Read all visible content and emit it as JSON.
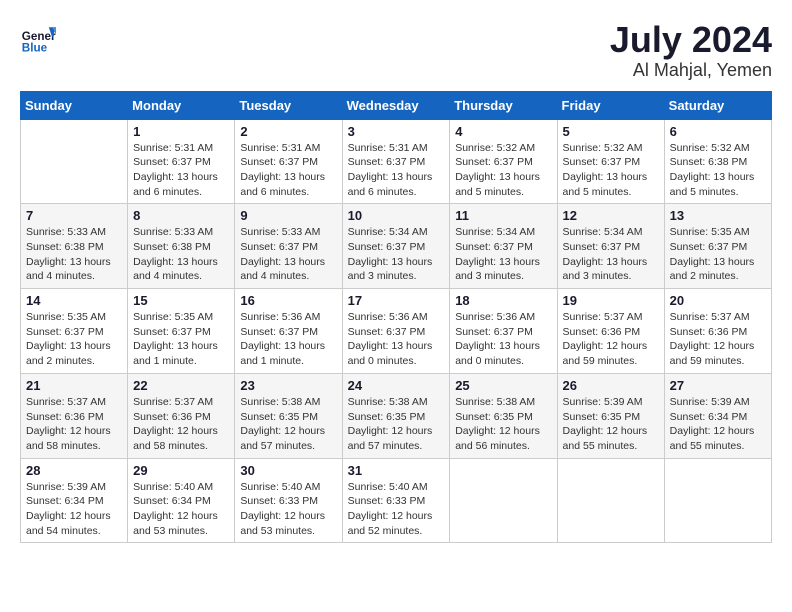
{
  "header": {
    "logo_line1": "General",
    "logo_line2": "Blue",
    "month": "July 2024",
    "location": "Al Mahjal, Yemen"
  },
  "weekdays": [
    "Sunday",
    "Monday",
    "Tuesday",
    "Wednesday",
    "Thursday",
    "Friday",
    "Saturday"
  ],
  "weeks": [
    [
      {
        "day": "",
        "info": ""
      },
      {
        "day": "1",
        "info": "Sunrise: 5:31 AM\nSunset: 6:37 PM\nDaylight: 13 hours\nand 6 minutes."
      },
      {
        "day": "2",
        "info": "Sunrise: 5:31 AM\nSunset: 6:37 PM\nDaylight: 13 hours\nand 6 minutes."
      },
      {
        "day": "3",
        "info": "Sunrise: 5:31 AM\nSunset: 6:37 PM\nDaylight: 13 hours\nand 6 minutes."
      },
      {
        "day": "4",
        "info": "Sunrise: 5:32 AM\nSunset: 6:37 PM\nDaylight: 13 hours\nand 5 minutes."
      },
      {
        "day": "5",
        "info": "Sunrise: 5:32 AM\nSunset: 6:37 PM\nDaylight: 13 hours\nand 5 minutes."
      },
      {
        "day": "6",
        "info": "Sunrise: 5:32 AM\nSunset: 6:38 PM\nDaylight: 13 hours\nand 5 minutes."
      }
    ],
    [
      {
        "day": "7",
        "info": "Sunrise: 5:33 AM\nSunset: 6:38 PM\nDaylight: 13 hours\nand 4 minutes."
      },
      {
        "day": "8",
        "info": "Sunrise: 5:33 AM\nSunset: 6:38 PM\nDaylight: 13 hours\nand 4 minutes."
      },
      {
        "day": "9",
        "info": "Sunrise: 5:33 AM\nSunset: 6:37 PM\nDaylight: 13 hours\nand 4 minutes."
      },
      {
        "day": "10",
        "info": "Sunrise: 5:34 AM\nSunset: 6:37 PM\nDaylight: 13 hours\nand 3 minutes."
      },
      {
        "day": "11",
        "info": "Sunrise: 5:34 AM\nSunset: 6:37 PM\nDaylight: 13 hours\nand 3 minutes."
      },
      {
        "day": "12",
        "info": "Sunrise: 5:34 AM\nSunset: 6:37 PM\nDaylight: 13 hours\nand 3 minutes."
      },
      {
        "day": "13",
        "info": "Sunrise: 5:35 AM\nSunset: 6:37 PM\nDaylight: 13 hours\nand 2 minutes."
      }
    ],
    [
      {
        "day": "14",
        "info": "Sunrise: 5:35 AM\nSunset: 6:37 PM\nDaylight: 13 hours\nand 2 minutes."
      },
      {
        "day": "15",
        "info": "Sunrise: 5:35 AM\nSunset: 6:37 PM\nDaylight: 13 hours\nand 1 minute."
      },
      {
        "day": "16",
        "info": "Sunrise: 5:36 AM\nSunset: 6:37 PM\nDaylight: 13 hours\nand 1 minute."
      },
      {
        "day": "17",
        "info": "Sunrise: 5:36 AM\nSunset: 6:37 PM\nDaylight: 13 hours\nand 0 minutes."
      },
      {
        "day": "18",
        "info": "Sunrise: 5:36 AM\nSunset: 6:37 PM\nDaylight: 13 hours\nand 0 minutes."
      },
      {
        "day": "19",
        "info": "Sunrise: 5:37 AM\nSunset: 6:36 PM\nDaylight: 12 hours\nand 59 minutes."
      },
      {
        "day": "20",
        "info": "Sunrise: 5:37 AM\nSunset: 6:36 PM\nDaylight: 12 hours\nand 59 minutes."
      }
    ],
    [
      {
        "day": "21",
        "info": "Sunrise: 5:37 AM\nSunset: 6:36 PM\nDaylight: 12 hours\nand 58 minutes."
      },
      {
        "day": "22",
        "info": "Sunrise: 5:37 AM\nSunset: 6:36 PM\nDaylight: 12 hours\nand 58 minutes."
      },
      {
        "day": "23",
        "info": "Sunrise: 5:38 AM\nSunset: 6:35 PM\nDaylight: 12 hours\nand 57 minutes."
      },
      {
        "day": "24",
        "info": "Sunrise: 5:38 AM\nSunset: 6:35 PM\nDaylight: 12 hours\nand 57 minutes."
      },
      {
        "day": "25",
        "info": "Sunrise: 5:38 AM\nSunset: 6:35 PM\nDaylight: 12 hours\nand 56 minutes."
      },
      {
        "day": "26",
        "info": "Sunrise: 5:39 AM\nSunset: 6:35 PM\nDaylight: 12 hours\nand 55 minutes."
      },
      {
        "day": "27",
        "info": "Sunrise: 5:39 AM\nSunset: 6:34 PM\nDaylight: 12 hours\nand 55 minutes."
      }
    ],
    [
      {
        "day": "28",
        "info": "Sunrise: 5:39 AM\nSunset: 6:34 PM\nDaylight: 12 hours\nand 54 minutes."
      },
      {
        "day": "29",
        "info": "Sunrise: 5:40 AM\nSunset: 6:34 PM\nDaylight: 12 hours\nand 53 minutes."
      },
      {
        "day": "30",
        "info": "Sunrise: 5:40 AM\nSunset: 6:33 PM\nDaylight: 12 hours\nand 53 minutes."
      },
      {
        "day": "31",
        "info": "Sunrise: 5:40 AM\nSunset: 6:33 PM\nDaylight: 12 hours\nand 52 minutes."
      },
      {
        "day": "",
        "info": ""
      },
      {
        "day": "",
        "info": ""
      },
      {
        "day": "",
        "info": ""
      }
    ]
  ]
}
